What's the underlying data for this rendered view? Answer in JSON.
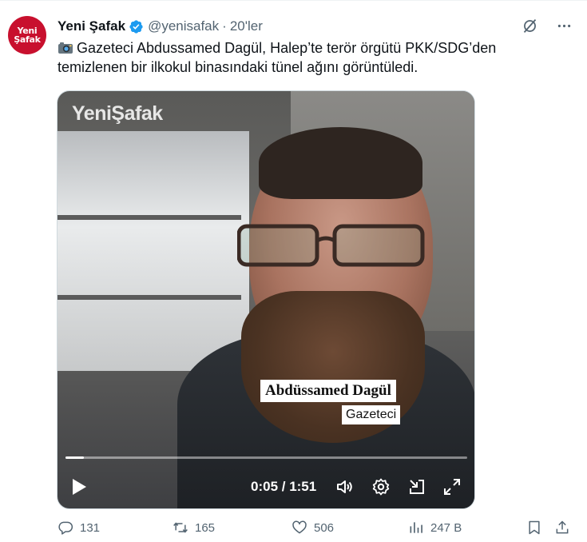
{
  "account": {
    "avatar_text_line1": "Yeni",
    "avatar_text_line2": "Şafak",
    "name": "Yeni Şafak",
    "handle": "@yenisafak",
    "separator": "·",
    "time": "20'ler"
  },
  "tweet": {
    "text_line1": "Gazeteci Abdussamed Dagül, Halep’te terör örgütü PKK/SDG’den",
    "text_line2": "temizlenen bir ilkokul binasındaki tünel ağını görüntüledi."
  },
  "video": {
    "watermark": "YeniŞafak",
    "lower_third_name": "Abdüssamed Dagül",
    "lower_third_title": "Gazeteci",
    "timecode": "0:05 / 1:51",
    "progress": 0.045
  },
  "actions": {
    "replies": "131",
    "reposts": "165",
    "likes": "506",
    "views": "247 B"
  },
  "colors": {
    "brand_red": "#c8102e",
    "verified_blue": "#1d9bf0",
    "muted": "#536471"
  },
  "icons": [
    "verified-badge-icon",
    "grok-icon",
    "more-icon",
    "camera-emoji-icon",
    "play-icon",
    "volume-icon",
    "settings-icon",
    "minimize-icon",
    "fullscreen-icon",
    "reply-icon",
    "repost-icon",
    "like-icon",
    "views-icon",
    "bookmark-icon",
    "share-icon"
  ]
}
